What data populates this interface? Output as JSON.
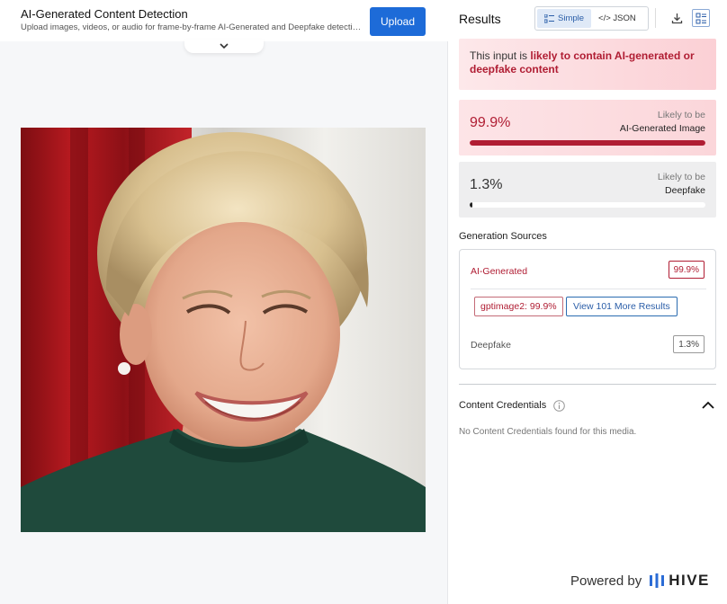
{
  "header": {
    "title": "AI-Generated Content Detection",
    "subtitle": "Upload images, videos, or audio for frame-by-frame AI-Generated and Deepfake detection with...",
    "upload_label": "Upload"
  },
  "results": {
    "title": "Results",
    "toggle": {
      "simple_label": "Simple",
      "json_label": "</> JSON",
      "selected": "Simple"
    },
    "alert": {
      "prefix": "This input is ",
      "emphasis": "likely to contain AI-generated or deepfake content"
    },
    "scores": [
      {
        "pct": "99.9%",
        "value": 0.999,
        "likely": "Likely to be",
        "label": "AI-Generated Image"
      },
      {
        "pct": "1.3%",
        "value": 0.013,
        "likely": "Likely to be",
        "label": "Deepfake"
      }
    ],
    "generation_sources": {
      "title": "Generation Sources",
      "ai_label": "AI-Generated",
      "ai_pct": "99.9%",
      "model_chip": "gptimage2: 99.9%",
      "more_label": "View 101 More Results",
      "deepfake_label": "Deepfake",
      "deepfake_pct": "1.3%"
    },
    "content_credentials": {
      "title": "Content Credentials",
      "none_text": "No Content Credentials found for this media."
    }
  },
  "footer": {
    "powered_by": "Powered by",
    "brand": "HIVE"
  },
  "colors": {
    "accent_red": "#b01d33",
    "primary_blue": "#1d6bd8"
  }
}
